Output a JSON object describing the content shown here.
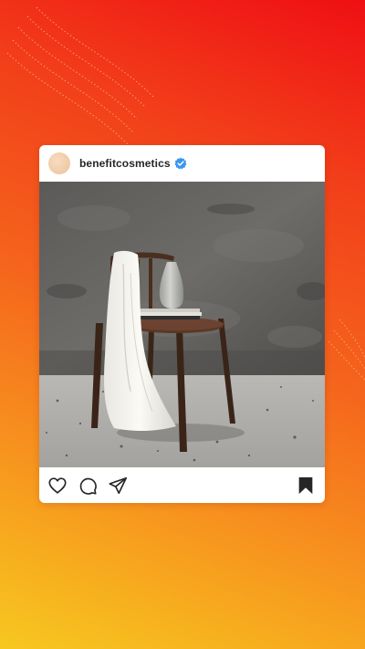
{
  "post": {
    "username": "benefitcosmetics",
    "verified": true,
    "photo_subject": "wooden chair with vase, books and draped white cloth against concrete wall",
    "icons": {
      "avatar": "profile-avatar",
      "verified": "verified-badge-icon",
      "like": "heart-icon",
      "comment": "comment-bubble-icon",
      "share": "paper-plane-icon",
      "save": "bookmark-icon"
    }
  },
  "colors": {
    "gradient_top": "#ef0f14",
    "gradient_bottom": "#f7c81f",
    "verified_blue": "#3897f0",
    "text": "#262626"
  }
}
